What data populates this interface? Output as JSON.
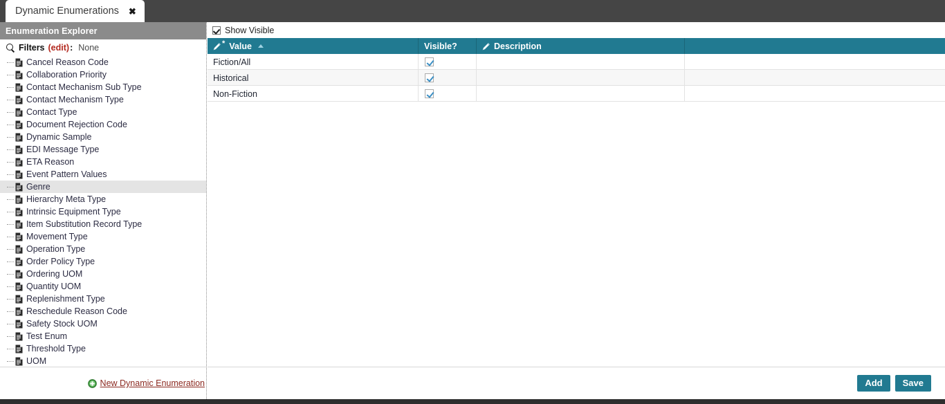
{
  "tab": {
    "title": "Dynamic Enumerations",
    "close_icon": "close-icon",
    "close_glyph": "✖"
  },
  "sidebar": {
    "header": "Enumeration Explorer",
    "filters": {
      "search_icon": "search-icon",
      "label": "Filters",
      "edit_link": "(edit)",
      "colon": ":",
      "value": "None"
    },
    "items": [
      {
        "label": "Cancel Reason Code",
        "selected": false
      },
      {
        "label": "Collaboration Priority",
        "selected": false
      },
      {
        "label": "Contact Mechanism Sub Type",
        "selected": false
      },
      {
        "label": "Contact Mechanism Type",
        "selected": false
      },
      {
        "label": "Contact Type",
        "selected": false
      },
      {
        "label": "Document Rejection Code",
        "selected": false
      },
      {
        "label": "Dynamic Sample",
        "selected": false
      },
      {
        "label": "EDI Message Type",
        "selected": false
      },
      {
        "label": "ETA Reason",
        "selected": false
      },
      {
        "label": "Event Pattern Values",
        "selected": false
      },
      {
        "label": "Genre",
        "selected": true
      },
      {
        "label": "Hierarchy Meta Type",
        "selected": false
      },
      {
        "label": "Intrinsic Equipment Type",
        "selected": false
      },
      {
        "label": "Item Substitution Record Type",
        "selected": false
      },
      {
        "label": "Movement Type",
        "selected": false
      },
      {
        "label": "Operation Type",
        "selected": false
      },
      {
        "label": "Order Policy Type",
        "selected": false
      },
      {
        "label": "Ordering UOM",
        "selected": false
      },
      {
        "label": "Quantity UOM",
        "selected": false
      },
      {
        "label": "Replenishment Type",
        "selected": false
      },
      {
        "label": "Reschedule Reason Code",
        "selected": false
      },
      {
        "label": "Safety Stock UOM",
        "selected": false
      },
      {
        "label": "Test Enum",
        "selected": false
      },
      {
        "label": "Threshold Type",
        "selected": false
      },
      {
        "label": "UOM",
        "selected": false
      }
    ],
    "footer": {
      "new_enum_icon": "plus-circle-icon",
      "new_enum_label": "New Dynamic Enumeration"
    }
  },
  "main": {
    "show_visible": {
      "label": "Show Visible",
      "checked": true
    },
    "grid": {
      "columns": [
        {
          "label": "Value",
          "icon": "pencil-icon",
          "required": "*",
          "sorted": "asc"
        },
        {
          "label": "Visible?",
          "icon": "",
          "required": "",
          "sorted": ""
        },
        {
          "label": "Description",
          "icon": "pencil-icon",
          "required": "",
          "sorted": ""
        }
      ],
      "rows": [
        {
          "value": "Fiction/All",
          "visible": true,
          "description": ""
        },
        {
          "value": "Historical",
          "visible": true,
          "description": ""
        },
        {
          "value": "Non-Fiction",
          "visible": true,
          "description": ""
        }
      ]
    },
    "footer": {
      "add_label": "Add",
      "save_label": "Save"
    }
  },
  "colors": {
    "accent_teal": "#217a91",
    "topbar_dark": "#454545",
    "sidebar_header_gray": "#8b8b8b",
    "link_red": "#8c2a21",
    "edit_red": "#b3281e",
    "selected_row": "#e4e4e4"
  }
}
